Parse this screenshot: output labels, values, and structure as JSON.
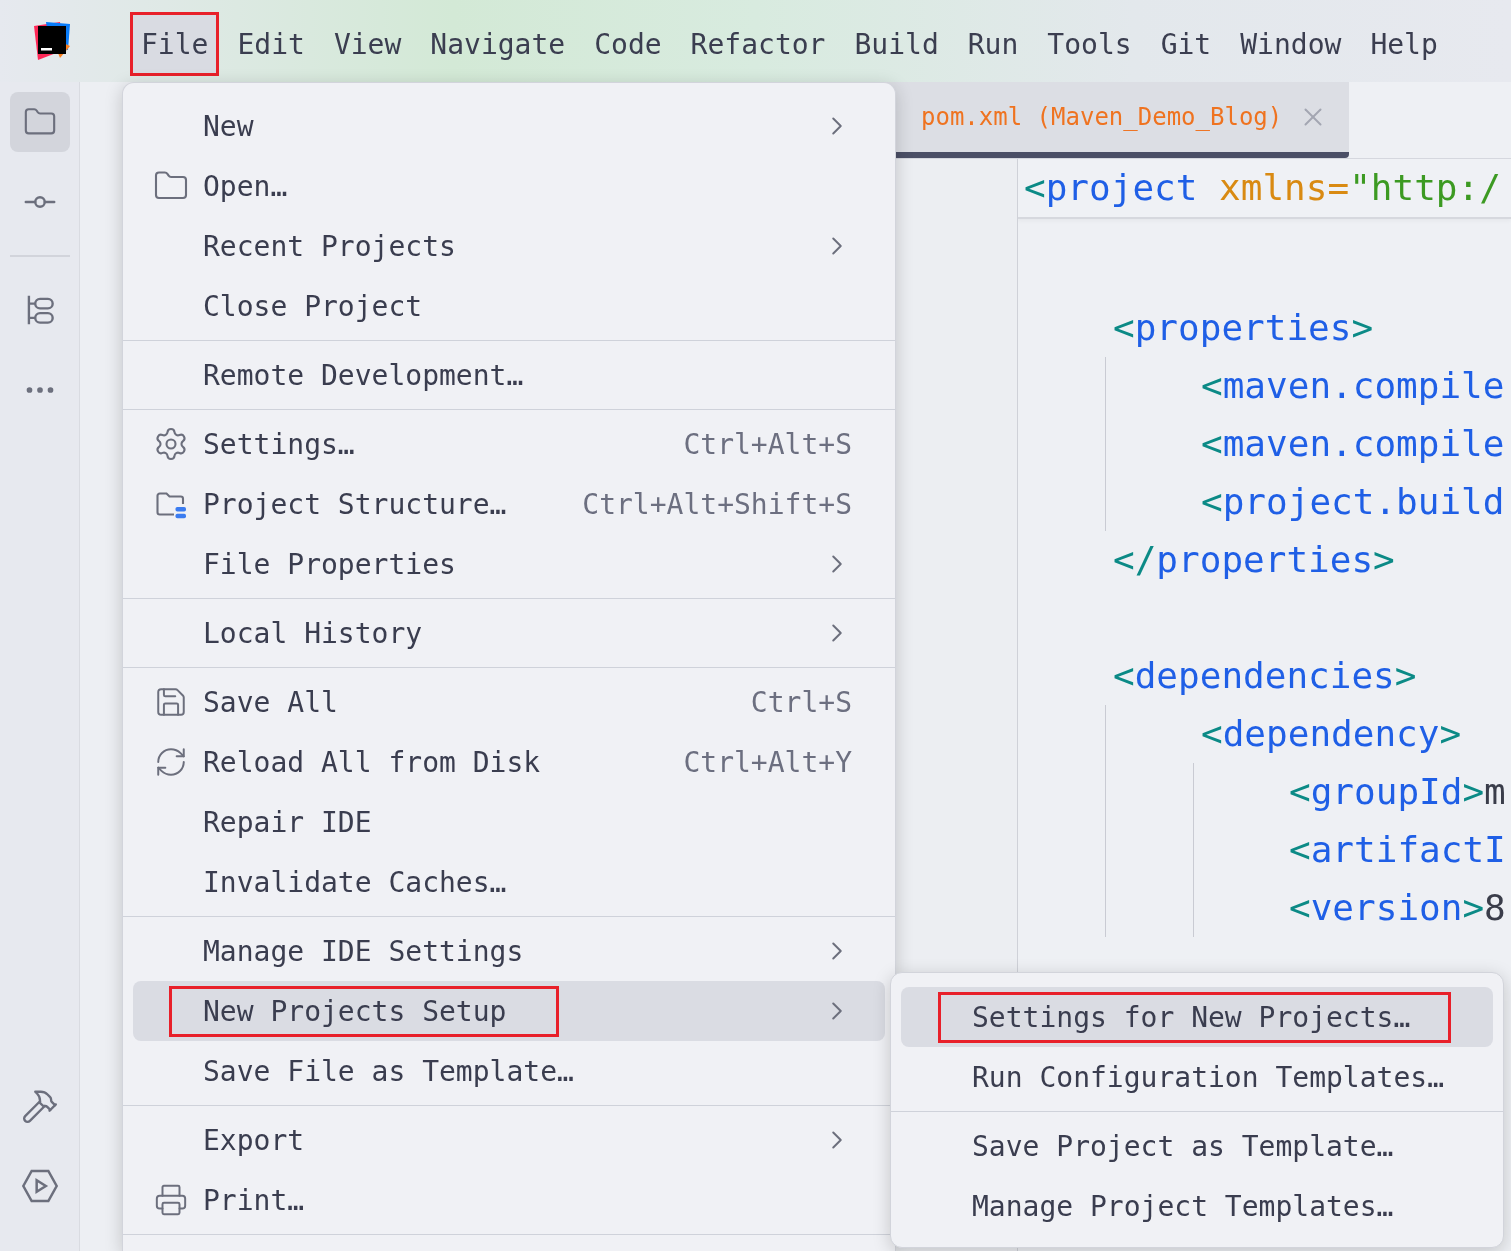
{
  "menu_bar": {
    "items": [
      {
        "label": "File",
        "selected": true,
        "annotated": true
      },
      {
        "label": "Edit",
        "selected": false
      },
      {
        "label": "View",
        "selected": false
      },
      {
        "label": "Navigate",
        "selected": false
      },
      {
        "label": "Code",
        "selected": false
      },
      {
        "label": "Refactor",
        "selected": false
      },
      {
        "label": "Build",
        "selected": false
      },
      {
        "label": "Run",
        "selected": false
      },
      {
        "label": "Tools",
        "selected": false
      },
      {
        "label": "Git",
        "selected": false
      },
      {
        "label": "Window",
        "selected": false
      },
      {
        "label": "Help",
        "selected": false
      }
    ]
  },
  "tool_strip": {
    "top": [
      {
        "selected": true
      },
      {
        "selected": false
      },
      {
        "selected": false
      },
      {
        "selected": false
      }
    ],
    "bottom": [
      {
        "selected": false
      },
      {
        "selected": false
      }
    ]
  },
  "editor": {
    "tab": {
      "file": "pom.xml",
      "project": "(Maven_Demo_Blog)",
      "selected": true
    },
    "sticky_line": {
      "tokens": [
        {
          "kind": "bracket",
          "text": "<"
        },
        {
          "kind": "tag",
          "text": "project"
        },
        {
          "kind": "attr",
          "text": " xmlns="
        },
        {
          "kind": "string",
          "text": "\"http:/"
        }
      ]
    },
    "lines": [
      {
        "tokens": [
          {
            "kind": "bracket",
            "text": "<"
          },
          {
            "kind": "tag",
            "text": "properties"
          },
          {
            "kind": "bracket",
            "text": ">"
          }
        ],
        "children": [
          {
            "tokens": [
              {
                "kind": "bracket",
                "text": "<"
              },
              {
                "kind": "tag",
                "text": "maven.compile"
              }
            ]
          },
          {
            "tokens": [
              {
                "kind": "bracket",
                "text": "<"
              },
              {
                "kind": "tag",
                "text": "maven.compile"
              }
            ]
          },
          {
            "tokens": [
              {
                "kind": "bracket",
                "text": "<"
              },
              {
                "kind": "tag",
                "text": "project.build"
              }
            ]
          }
        ]
      },
      {
        "tokens": [
          {
            "kind": "bracket",
            "text": "</"
          },
          {
            "kind": "tag",
            "text": "properties"
          },
          {
            "kind": "bracket",
            "text": ">"
          }
        ]
      },
      {
        "blank_before": true,
        "tokens": [
          {
            "kind": "bracket",
            "text": "<"
          },
          {
            "kind": "tag",
            "text": "dependencies"
          },
          {
            "kind": "bracket",
            "text": ">"
          }
        ],
        "children": [
          {
            "tokens": [
              {
                "kind": "bracket",
                "text": "<"
              },
              {
                "kind": "tag",
                "text": "dependency"
              },
              {
                "kind": "bracket",
                "text": ">"
              }
            ],
            "children": [
              {
                "tokens": [
                  {
                    "kind": "bracket",
                    "text": "<"
                  },
                  {
                    "kind": "tag",
                    "text": "groupId"
                  },
                  {
                    "kind": "bracket",
                    "text": ">"
                  },
                  {
                    "kind": "text",
                    "text": "m"
                  }
                ]
              },
              {
                "tokens": [
                  {
                    "kind": "bracket",
                    "text": "<"
                  },
                  {
                    "kind": "tag",
                    "text": "artifactI"
                  }
                ]
              },
              {
                "tokens": [
                  {
                    "kind": "bracket",
                    "text": "<"
                  },
                  {
                    "kind": "tag",
                    "text": "version"
                  },
                  {
                    "kind": "bracket",
                    "text": ">"
                  },
                  {
                    "kind": "text",
                    "text": "8"
                  }
                ]
              }
            ]
          }
        ]
      }
    ]
  },
  "file_menu": {
    "items": [
      {
        "kind": "item",
        "label": "New",
        "submenu": true,
        "selected": false
      },
      {
        "kind": "item",
        "label": "Open…",
        "selected": false
      },
      {
        "kind": "item",
        "label": "Recent Projects",
        "submenu": true,
        "selected": false
      },
      {
        "kind": "item",
        "label": "Close Project",
        "selected": false
      },
      {
        "kind": "separator"
      },
      {
        "kind": "item",
        "label": "Remote Development…",
        "selected": false
      },
      {
        "kind": "separator"
      },
      {
        "kind": "item",
        "label": "Settings…",
        "shortcut": "Ctrl+Alt+S",
        "selected": false
      },
      {
        "kind": "item",
        "label": "Project Structure…",
        "shortcut": "Ctrl+Alt+Shift+S",
        "selected": false
      },
      {
        "kind": "item",
        "label": "File Properties",
        "submenu": true,
        "selected": false
      },
      {
        "kind": "separator"
      },
      {
        "kind": "item",
        "label": "Local History",
        "submenu": true,
        "selected": false
      },
      {
        "kind": "separator"
      },
      {
        "kind": "item",
        "label": "Save All",
        "shortcut": "Ctrl+S",
        "selected": false
      },
      {
        "kind": "item",
        "label": "Reload All from Disk",
        "shortcut": "Ctrl+Alt+Y",
        "selected": false
      },
      {
        "kind": "item",
        "label": "Repair IDE",
        "selected": false
      },
      {
        "kind": "item",
        "label": "Invalidate Caches…",
        "selected": false
      },
      {
        "kind": "separator"
      },
      {
        "kind": "item",
        "label": "Manage IDE Settings",
        "submenu": true,
        "selected": false
      },
      {
        "kind": "item",
        "label": "New Projects Setup",
        "submenu": true,
        "selected": true,
        "annotated": true
      },
      {
        "kind": "item",
        "label": "Save File as Template…",
        "selected": false
      },
      {
        "kind": "separator"
      },
      {
        "kind": "item",
        "label": "Export",
        "submenu": true,
        "selected": false
      },
      {
        "kind": "item",
        "label": "Print…",
        "selected": false
      },
      {
        "kind": "separator"
      }
    ]
  },
  "submenu": {
    "items": [
      {
        "kind": "item",
        "label": "Settings for New Projects…",
        "selected": true,
        "annotated": true
      },
      {
        "kind": "item",
        "label": "Run Configuration Templates…",
        "selected": false
      },
      {
        "kind": "separator"
      },
      {
        "kind": "item",
        "label": "Save Project as Template…",
        "selected": false
      },
      {
        "kind": "item",
        "label": "Manage Project Templates…",
        "selected": false
      }
    ]
  }
}
